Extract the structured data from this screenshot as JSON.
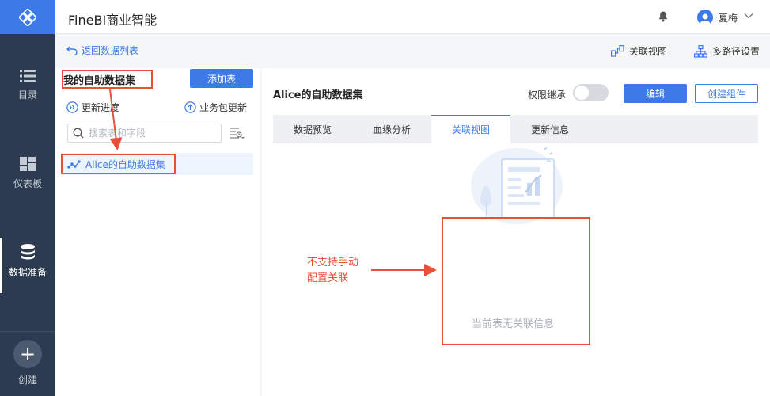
{
  "app": {
    "title": "FineBI商业智能"
  },
  "user": {
    "name": "夏梅"
  },
  "nav": {
    "items": [
      {
        "label": "目录"
      },
      {
        "label": "仪表板"
      },
      {
        "label": "数据准备"
      },
      {
        "label": "创建"
      }
    ]
  },
  "toolbar": {
    "back_label": "返回数据列表",
    "relation_view_label": "关联视图",
    "multipath_label": "多路径设置"
  },
  "left_panel": {
    "title": "我的自助数据集",
    "add_table_label": "添加表",
    "update_progress_label": "更新进度",
    "business_pack_update_label": "业务包更新",
    "search_placeholder": "搜索表和字段",
    "tree_item_label": "Alice的自助数据集"
  },
  "right_panel": {
    "title": "Alice的自助数据集",
    "permission_label": "权限继承",
    "permission_on": false,
    "edit_label": "编辑",
    "create_component_label": "创建组件",
    "tabs": [
      {
        "label": "数据预览"
      },
      {
        "label": "血缘分析"
      },
      {
        "label": "关联视图",
        "active": true
      },
      {
        "label": "更新信息"
      }
    ],
    "empty_text": "当前表无关联信息"
  },
  "annotation": {
    "line1": "不支持手动",
    "line2": "配置关联",
    "color": "#e8503a"
  },
  "colors": {
    "accent": "#3d7ae8",
    "nav_bg": "#2c3b4f"
  }
}
